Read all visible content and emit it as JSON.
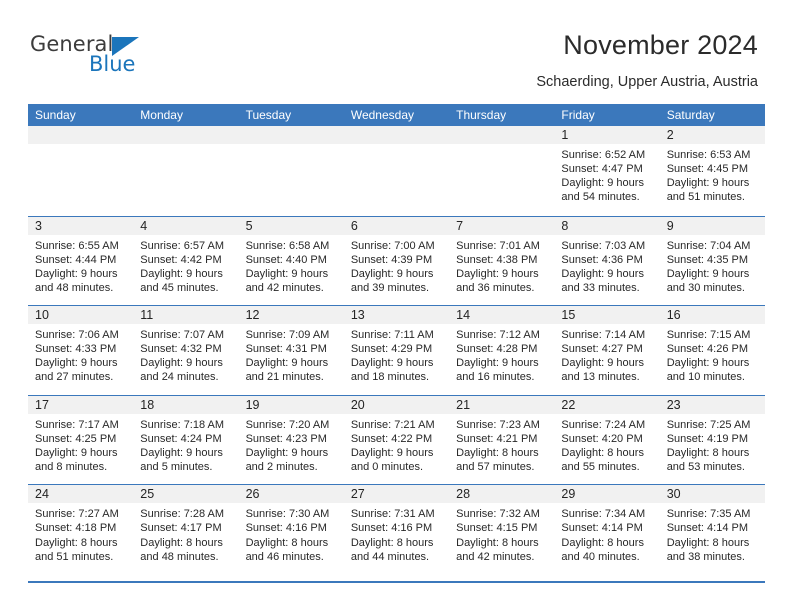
{
  "brand": {
    "name_part1": "General",
    "name_part2": "Blue",
    "triangle_icon": "blue-triangle-icon",
    "colors": {
      "general_text": "#3c3c3c",
      "blue_text": "#1b75bb",
      "header_blue": "#3b78bc",
      "daynum_strip": "#f1f1f1"
    }
  },
  "header": {
    "title": "November 2024",
    "subtitle": "Schaerding, Upper Austria, Austria"
  },
  "calendar": {
    "weekday_headers": [
      "Sunday",
      "Monday",
      "Tuesday",
      "Wednesday",
      "Thursday",
      "Friday",
      "Saturday"
    ],
    "weeks": [
      [
        {
          "day": "",
          "lines": []
        },
        {
          "day": "",
          "lines": []
        },
        {
          "day": "",
          "lines": []
        },
        {
          "day": "",
          "lines": []
        },
        {
          "day": "",
          "lines": []
        },
        {
          "day": "1",
          "lines": [
            "Sunrise: 6:52 AM",
            "Sunset: 4:47 PM",
            "Daylight: 9 hours",
            "and 54 minutes."
          ]
        },
        {
          "day": "2",
          "lines": [
            "Sunrise: 6:53 AM",
            "Sunset: 4:45 PM",
            "Daylight: 9 hours",
            "and 51 minutes."
          ]
        }
      ],
      [
        {
          "day": "3",
          "lines": [
            "Sunrise: 6:55 AM",
            "Sunset: 4:44 PM",
            "Daylight: 9 hours",
            "and 48 minutes."
          ]
        },
        {
          "day": "4",
          "lines": [
            "Sunrise: 6:57 AM",
            "Sunset: 4:42 PM",
            "Daylight: 9 hours",
            "and 45 minutes."
          ]
        },
        {
          "day": "5",
          "lines": [
            "Sunrise: 6:58 AM",
            "Sunset: 4:40 PM",
            "Daylight: 9 hours",
            "and 42 minutes."
          ]
        },
        {
          "day": "6",
          "lines": [
            "Sunrise: 7:00 AM",
            "Sunset: 4:39 PM",
            "Daylight: 9 hours",
            "and 39 minutes."
          ]
        },
        {
          "day": "7",
          "lines": [
            "Sunrise: 7:01 AM",
            "Sunset: 4:38 PM",
            "Daylight: 9 hours",
            "and 36 minutes."
          ]
        },
        {
          "day": "8",
          "lines": [
            "Sunrise: 7:03 AM",
            "Sunset: 4:36 PM",
            "Daylight: 9 hours",
            "and 33 minutes."
          ]
        },
        {
          "day": "9",
          "lines": [
            "Sunrise: 7:04 AM",
            "Sunset: 4:35 PM",
            "Daylight: 9 hours",
            "and 30 minutes."
          ]
        }
      ],
      [
        {
          "day": "10",
          "lines": [
            "Sunrise: 7:06 AM",
            "Sunset: 4:33 PM",
            "Daylight: 9 hours",
            "and 27 minutes."
          ]
        },
        {
          "day": "11",
          "lines": [
            "Sunrise: 7:07 AM",
            "Sunset: 4:32 PM",
            "Daylight: 9 hours",
            "and 24 minutes."
          ]
        },
        {
          "day": "12",
          "lines": [
            "Sunrise: 7:09 AM",
            "Sunset: 4:31 PM",
            "Daylight: 9 hours",
            "and 21 minutes."
          ]
        },
        {
          "day": "13",
          "lines": [
            "Sunrise: 7:11 AM",
            "Sunset: 4:29 PM",
            "Daylight: 9 hours",
            "and 18 minutes."
          ]
        },
        {
          "day": "14",
          "lines": [
            "Sunrise: 7:12 AM",
            "Sunset: 4:28 PM",
            "Daylight: 9 hours",
            "and 16 minutes."
          ]
        },
        {
          "day": "15",
          "lines": [
            "Sunrise: 7:14 AM",
            "Sunset: 4:27 PM",
            "Daylight: 9 hours",
            "and 13 minutes."
          ]
        },
        {
          "day": "16",
          "lines": [
            "Sunrise: 7:15 AM",
            "Sunset: 4:26 PM",
            "Daylight: 9 hours",
            "and 10 minutes."
          ]
        }
      ],
      [
        {
          "day": "17",
          "lines": [
            "Sunrise: 7:17 AM",
            "Sunset: 4:25 PM",
            "Daylight: 9 hours",
            "and 8 minutes."
          ]
        },
        {
          "day": "18",
          "lines": [
            "Sunrise: 7:18 AM",
            "Sunset: 4:24 PM",
            "Daylight: 9 hours",
            "and 5 minutes."
          ]
        },
        {
          "day": "19",
          "lines": [
            "Sunrise: 7:20 AM",
            "Sunset: 4:23 PM",
            "Daylight: 9 hours",
            "and 2 minutes."
          ]
        },
        {
          "day": "20",
          "lines": [
            "Sunrise: 7:21 AM",
            "Sunset: 4:22 PM",
            "Daylight: 9 hours",
            "and 0 minutes."
          ]
        },
        {
          "day": "21",
          "lines": [
            "Sunrise: 7:23 AM",
            "Sunset: 4:21 PM",
            "Daylight: 8 hours",
            "and 57 minutes."
          ]
        },
        {
          "day": "22",
          "lines": [
            "Sunrise: 7:24 AM",
            "Sunset: 4:20 PM",
            "Daylight: 8 hours",
            "and 55 minutes."
          ]
        },
        {
          "day": "23",
          "lines": [
            "Sunrise: 7:25 AM",
            "Sunset: 4:19 PM",
            "Daylight: 8 hours",
            "and 53 minutes."
          ]
        }
      ],
      [
        {
          "day": "24",
          "lines": [
            "Sunrise: 7:27 AM",
            "Sunset: 4:18 PM",
            "Daylight: 8 hours",
            "and 51 minutes."
          ]
        },
        {
          "day": "25",
          "lines": [
            "Sunrise: 7:28 AM",
            "Sunset: 4:17 PM",
            "Daylight: 8 hours",
            "and 48 minutes."
          ]
        },
        {
          "day": "26",
          "lines": [
            "Sunrise: 7:30 AM",
            "Sunset: 4:16 PM",
            "Daylight: 8 hours",
            "and 46 minutes."
          ]
        },
        {
          "day": "27",
          "lines": [
            "Sunrise: 7:31 AM",
            "Sunset: 4:16 PM",
            "Daylight: 8 hours",
            "and 44 minutes."
          ]
        },
        {
          "day": "28",
          "lines": [
            "Sunrise: 7:32 AM",
            "Sunset: 4:15 PM",
            "Daylight: 8 hours",
            "and 42 minutes."
          ]
        },
        {
          "day": "29",
          "lines": [
            "Sunrise: 7:34 AM",
            "Sunset: 4:14 PM",
            "Daylight: 8 hours",
            "and 40 minutes."
          ]
        },
        {
          "day": "30",
          "lines": [
            "Sunrise: 7:35 AM",
            "Sunset: 4:14 PM",
            "Daylight: 8 hours",
            "and 38 minutes."
          ]
        }
      ]
    ]
  }
}
